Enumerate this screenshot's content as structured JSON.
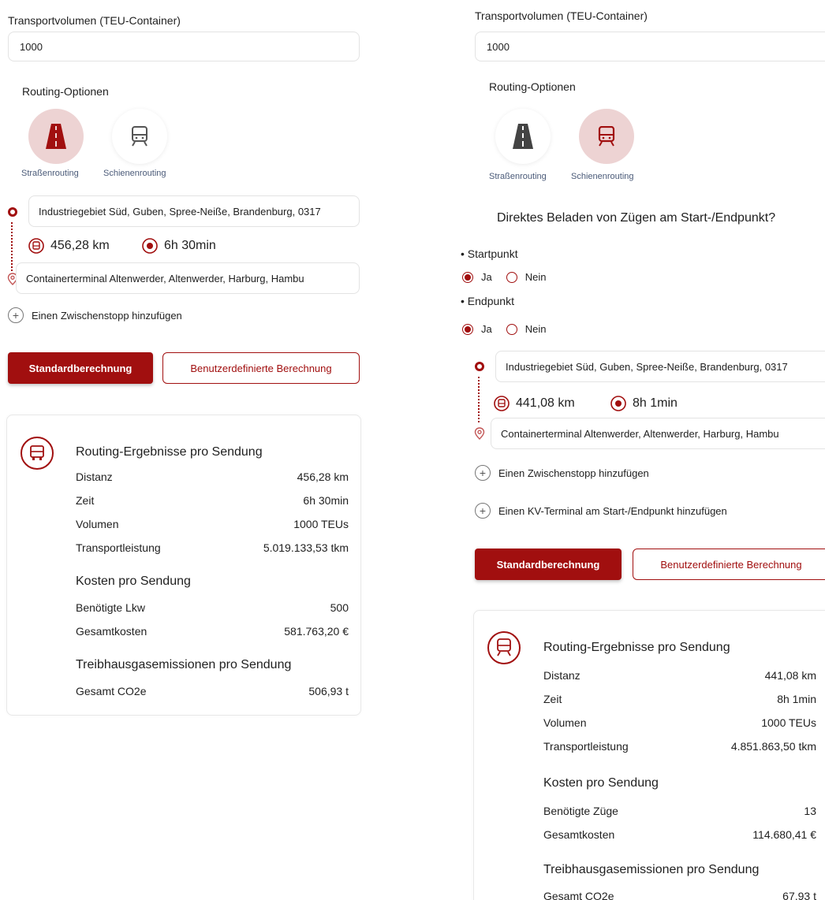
{
  "left": {
    "volume_label": "Transportvolumen (TEU-Container)",
    "volume_value": "1000",
    "routing_title": "Routing-Optionen",
    "mode_road": "Straßenrouting",
    "mode_rail": "Schienenrouting",
    "active_mode": "road",
    "start": "Industriegebiet Süd, Guben, Spree-Neiße, Brandenburg, 0317",
    "distance": "456,28 km",
    "duration": "6h 30min",
    "end": "Containerterminal Altenwerder, Altenwerder, Harburg, Hambu",
    "add_stop": "Einen Zwischenstopp hinzufügen",
    "btn_standard": "Standardberechnung",
    "btn_custom": "Benutzerdefinierte Berechnung",
    "results": {
      "heading": "Routing-Ergebnisse pro Sendung",
      "rows": [
        {
          "k": "Distanz",
          "v": "456,28 km"
        },
        {
          "k": "Zeit",
          "v": "6h 30min"
        },
        {
          "k": "Volumen",
          "v": "1000 TEUs"
        },
        {
          "k": "Transportleistung",
          "v": "5.019.133,53 tkm"
        }
      ],
      "cost_heading": "Kosten pro Sendung",
      "cost_rows": [
        {
          "k": "Benötigte Lkw",
          "v": "500"
        },
        {
          "k": "Gesamtkosten",
          "v": "581.763,20 €"
        }
      ],
      "ghg_heading": "Treibhausgasemissionen pro Sendung",
      "ghg_rows": [
        {
          "k": "Gesamt CO2e",
          "v": "506,93 t"
        }
      ]
    }
  },
  "right": {
    "volume_label": "Transportvolumen (TEU-Container)",
    "volume_value": "1000",
    "routing_title": "Routing-Optionen",
    "mode_road": "Straßenrouting",
    "mode_rail": "Schienenrouting",
    "active_mode": "rail",
    "question": "Direktes Beladen von Zügen am Start-/Endpunkt?",
    "startpunkt": "Startpunkt",
    "endpunkt": "Endpunkt",
    "ja": "Ja",
    "nein": "Nein",
    "start": "Industriegebiet Süd, Guben, Spree-Neiße, Brandenburg, 0317",
    "distance": "441,08 km",
    "duration": "8h 1min",
    "end": "Containerterminal Altenwerder, Altenwerder, Harburg, Hambu",
    "add_stop": "Einen Zwischenstopp hinzufügen",
    "add_kv": "Einen KV-Terminal am Start-/Endpunkt hinzufügen",
    "btn_standard": "Standardberechnung",
    "btn_custom": "Benutzerdefinierte Berechnung",
    "results": {
      "heading": "Routing-Ergebnisse pro Sendung",
      "rows": [
        {
          "k": "Distanz",
          "v": "441,08 km"
        },
        {
          "k": "Zeit",
          "v": "8h 1min"
        },
        {
          "k": "Volumen",
          "v": "1000 TEUs"
        },
        {
          "k": "Transportleistung",
          "v": "4.851.863,50 tkm"
        }
      ],
      "cost_heading": "Kosten pro Sendung",
      "cost_rows": [
        {
          "k": "Benötigte Züge",
          "v": "13"
        },
        {
          "k": "Gesamtkosten",
          "v": "114.680,41 €"
        }
      ],
      "ghg_heading": "Treibhausgasemissionen pro Sendung",
      "ghg_rows": [
        {
          "k": "Gesamt CO2e",
          "v": "67,93 t"
        }
      ]
    }
  },
  "colors": {
    "brand": "#a10f0f",
    "active_mode_bg": "#edd3d3",
    "mode_label": "#4a5a78"
  }
}
